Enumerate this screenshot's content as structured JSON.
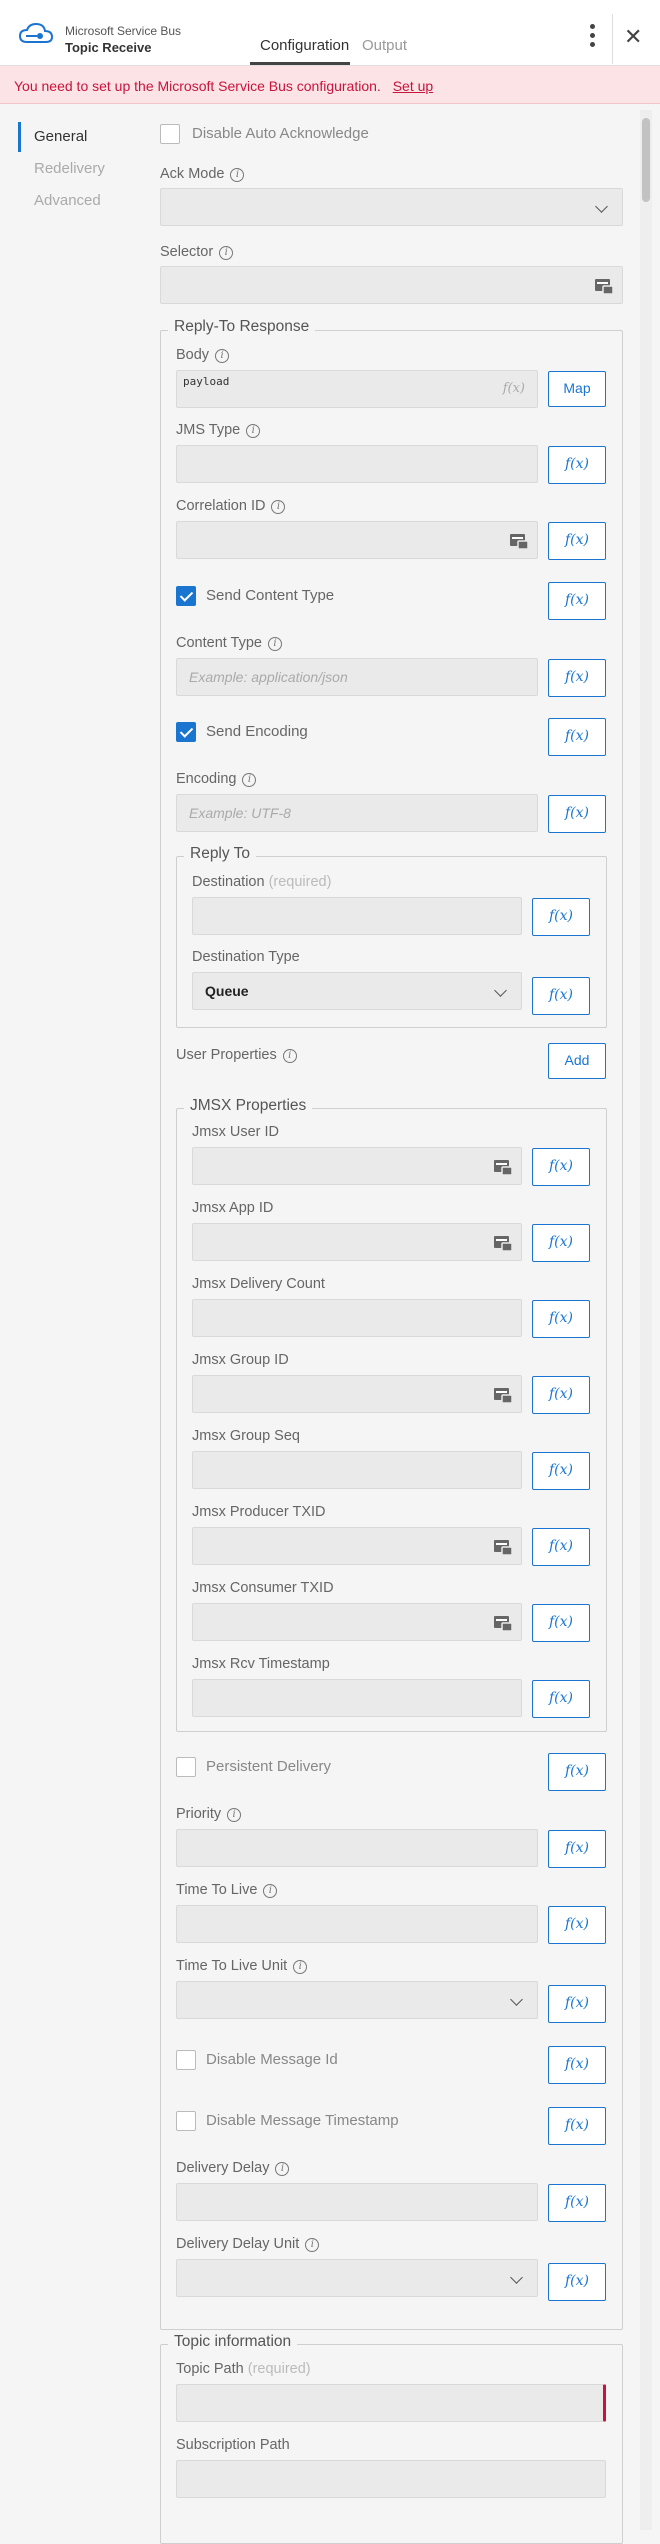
{
  "header": {
    "app_name": "Microsoft Service Bus",
    "activity_name": "Topic Receive",
    "tabs": [
      {
        "label": "Configuration",
        "active": true
      },
      {
        "label": "Output",
        "active": false
      }
    ],
    "close_glyph": "✕"
  },
  "banner": {
    "message": "You need to set up the Microsoft Service Bus configuration.",
    "link": "Set up"
  },
  "nav": {
    "items": [
      {
        "label": "General",
        "active": true
      },
      {
        "label": "Redelivery",
        "active": false
      },
      {
        "label": "Advanced",
        "active": false
      }
    ]
  },
  "general": {
    "disable_auto_ack": {
      "label": "Disable Auto Acknowledge",
      "checked": false
    },
    "ack_mode": {
      "label": "Ack Mode",
      "value": ""
    },
    "selector": {
      "label": "Selector",
      "value": ""
    }
  },
  "reply_to_response": {
    "legend": "Reply-To Response",
    "body": {
      "label": "Body",
      "value": "payload",
      "fx_hint": "f(x)",
      "map_button": "Map"
    },
    "jms_type": {
      "label": "JMS Type"
    },
    "correlation_id": {
      "label": "Correlation ID"
    },
    "send_content_type": {
      "label": "Send Content Type",
      "checked": true
    },
    "content_type": {
      "label": "Content Type",
      "placeholder": "Example: application/json"
    },
    "send_encoding": {
      "label": "Send Encoding",
      "checked": true
    },
    "encoding": {
      "label": "Encoding",
      "placeholder": "Example: UTF-8"
    },
    "reply_to": {
      "legend": "Reply To",
      "destination": {
        "label": "Destination",
        "required": "(required)"
      },
      "destination_type": {
        "label": "Destination Type",
        "value": "Queue"
      }
    },
    "user_properties": {
      "label": "User Properties",
      "add_button": "Add"
    },
    "jmsx": {
      "legend": "JMSX Properties",
      "user_id": "Jmsx User ID",
      "app_id": "Jmsx App ID",
      "delivery_count": "Jmsx Delivery Count",
      "group_id": "Jmsx Group ID",
      "group_seq": "Jmsx Group Seq",
      "producer_txid": "Jmsx Producer TXID",
      "consumer_txid": "Jmsx Consumer TXID",
      "rcv_timestamp": "Jmsx Rcv Timestamp"
    },
    "persistent_delivery": {
      "label": "Persistent Delivery",
      "checked": false
    },
    "priority": {
      "label": "Priority"
    },
    "time_to_live": {
      "label": "Time To Live"
    },
    "time_to_live_unit": {
      "label": "Time To Live Unit",
      "value": ""
    },
    "disable_message_id": {
      "label": "Disable Message Id",
      "checked": false
    },
    "disable_message_timestamp": {
      "label": "Disable Message Timestamp",
      "checked": false
    },
    "delivery_delay": {
      "label": "Delivery Delay"
    },
    "delivery_delay_unit": {
      "label": "Delivery Delay Unit",
      "value": ""
    }
  },
  "topic_information": {
    "legend": "Topic information",
    "topic_path": {
      "label": "Topic Path",
      "required": "(required)"
    },
    "subscription_path": {
      "label": "Subscription Path"
    }
  },
  "fx_label": "f(x)",
  "colors": {
    "accent": "#1a75d1",
    "error": "#c8143c",
    "banner_bg": "#fbe3e6"
  }
}
